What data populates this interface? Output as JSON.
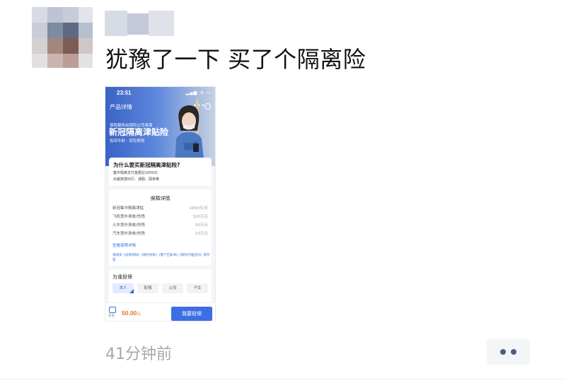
{
  "post": {
    "text": "犹豫了一下 买了个隔离险",
    "timestamp": "41分钟前"
  },
  "icons": {
    "avatar": "avatar-image",
    "more_actions": "more-dots-icon"
  },
  "shared_screenshot": {
    "status_time": "23:51",
    "page_title": "产品详情",
    "banner_small": "保险服务由保险公司承保",
    "banner_title": "新冠隔离津贴险",
    "banner_sub": "投保年龄 · 保险期限",
    "why_title": "为什么要买新冠隔离津贴险?",
    "why_bullets": [
      "集中隔离支付金额达1000元",
      "出差旅游出行、通勤、探亲等"
    ],
    "coverage_title": "保障详情",
    "coverage_items": [
      {
        "name": "新冠集中隔离津贴",
        "amount": "1000元/天"
      },
      {
        "name": "飞机意外身故/伤残",
        "amount": "320万元"
      },
      {
        "name": "火车意外身故/伤残",
        "amount": "50万元"
      },
      {
        "name": "汽车意外身故/伤残",
        "amount": "10万元"
      }
    ],
    "coverage_more": "查看保障详情",
    "coverage_terms": "请阅读《投保须知》《保险条款》《客户告知书》《保险代理合同》等内容",
    "insured_title": "为谁投保",
    "relationship_options": [
      "本人",
      "配偶",
      "父母",
      "子女"
    ],
    "selected_relationship": "本人",
    "service_label": "客服",
    "price": "50.00",
    "price_unit": "元",
    "buy_button": "我要投保"
  },
  "colors": {
    "accent_blue": "#3c6fe4",
    "price_orange": "#e2712d",
    "timestamp_gray": "#a8a8a8"
  }
}
